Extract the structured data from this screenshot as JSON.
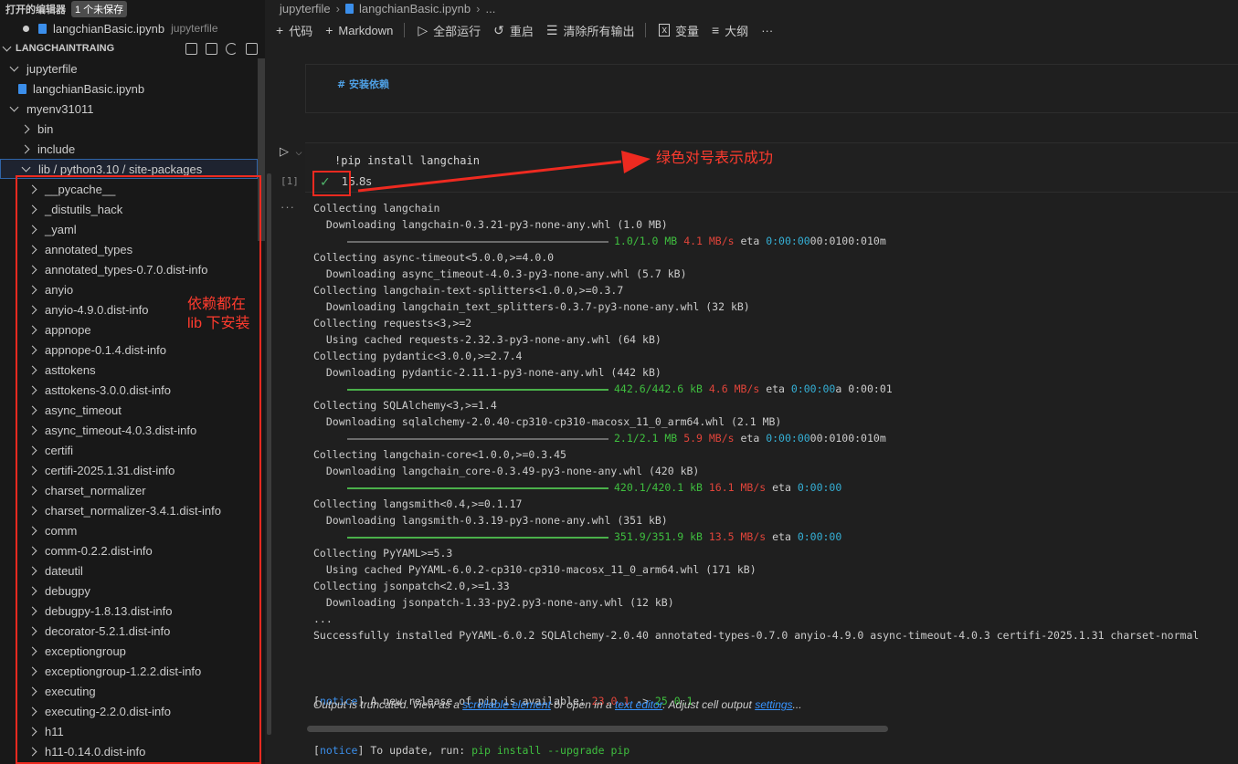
{
  "explorer": {
    "open_editors_label": "打开的编辑器",
    "unsaved_badge": "1 个未保存",
    "open_file": "langchianBasic.ipynb",
    "open_file_desc": "jupyterfile",
    "project": "LANGCHAINTRAING",
    "tree": [
      {
        "label": "jupyterfile",
        "expanded": true
      },
      {
        "label": "langchianBasic.ipynb",
        "file": true
      },
      {
        "label": "myenv31011",
        "expanded": true
      },
      {
        "label": "bin"
      },
      {
        "label": "include"
      },
      {
        "label": "lib / python3.10 / site-packages",
        "expanded": true
      },
      {
        "label": "__pycache__"
      },
      {
        "label": "_distutils_hack"
      },
      {
        "label": "_yaml"
      },
      {
        "label": "annotated_types"
      },
      {
        "label": "annotated_types-0.7.0.dist-info"
      },
      {
        "label": "anyio"
      },
      {
        "label": "anyio-4.9.0.dist-info"
      },
      {
        "label": "appnope"
      },
      {
        "label": "appnope-0.1.4.dist-info"
      },
      {
        "label": "asttokens"
      },
      {
        "label": "asttokens-3.0.0.dist-info"
      },
      {
        "label": "async_timeout"
      },
      {
        "label": "async_timeout-4.0.3.dist-info"
      },
      {
        "label": "certifi"
      },
      {
        "label": "certifi-2025.1.31.dist-info"
      },
      {
        "label": "charset_normalizer"
      },
      {
        "label": "charset_normalizer-3.4.1.dist-info"
      },
      {
        "label": "comm"
      },
      {
        "label": "comm-0.2.2.dist-info"
      },
      {
        "label": "dateutil"
      },
      {
        "label": "debugpy"
      },
      {
        "label": "debugpy-1.8.13.dist-info"
      },
      {
        "label": "decorator-5.2.1.dist-info"
      },
      {
        "label": "exceptiongroup"
      },
      {
        "label": "exceptiongroup-1.2.2.dist-info"
      },
      {
        "label": "executing"
      },
      {
        "label": "executing-2.2.0.dist-info"
      },
      {
        "label": "h11"
      },
      {
        "label": "h11-0.14.0.dist-info"
      }
    ]
  },
  "annotations": {
    "lib_note_line1": "依赖都在",
    "lib_note_line2": "lib 下安装",
    "success_note": "绿色对号表示成功",
    "color": "#ee2a20"
  },
  "breadcrumb": [
    "jupyterfile",
    "langchianBasic.ipynb",
    "..."
  ],
  "toolbar": {
    "code": "代码",
    "markdown": "Markdown",
    "run_all": "全部运行",
    "restart": "重启",
    "clear": "清除所有输出",
    "variables": "变量",
    "outline": "大纲",
    "more": "···"
  },
  "markdown_cell": "# 安装依赖",
  "code_cell": {
    "code": "!pip install langchain",
    "exec_count": "[1]",
    "duration": "15.8s",
    "status": "success"
  },
  "output": {
    "lines": [
      {
        "t": "Collecting langchain"
      },
      {
        "t": "  Downloading langchain-0.3.21-py3-none-any.whl (1.0 MB)"
      },
      {
        "bar": true,
        "green": false,
        "progress": 1.0,
        "size": "1.0/1.0 MB",
        "speed": "4.1 MB/s",
        "eta": "0:00:00",
        "tail": "00:0100:010m"
      },
      {
        "t": "Collecting async-timeout<5.0.0,>=4.0.0"
      },
      {
        "t": "  Downloading async_timeout-4.0.3-py3-none-any.whl (5.7 kB)"
      },
      {
        "t": "Collecting langchain-text-splitters<1.0.0,>=0.3.7"
      },
      {
        "t": "  Downloading langchain_text_splitters-0.3.7-py3-none-any.whl (32 kB)"
      },
      {
        "t": "Collecting requests<3,>=2"
      },
      {
        "t": "  Using cached requests-2.32.3-py3-none-any.whl (64 kB)"
      },
      {
        "t": "Collecting pydantic<3.0.0,>=2.7.4"
      },
      {
        "t": "  Downloading pydantic-2.11.1-py3-none-any.whl (442 kB)"
      },
      {
        "bar": true,
        "green": true,
        "progress": 1.0,
        "size": "442.6/442.6 kB",
        "speed": "4.6 MB/s",
        "eta": "0:00:00",
        "tail": "a 0:00:01"
      },
      {
        "t": "Collecting SQLAlchemy<3,>=1.4"
      },
      {
        "t": "  Downloading sqlalchemy-2.0.40-cp310-cp310-macosx_11_0_arm64.whl (2.1 MB)"
      },
      {
        "bar": true,
        "green": false,
        "progress": 1.0,
        "size": "2.1/2.1 MB",
        "speed": "5.9 MB/s",
        "eta": "0:00:00",
        "tail": "00:0100:010m"
      },
      {
        "t": "Collecting langchain-core<1.0.0,>=0.3.45"
      },
      {
        "t": "  Downloading langchain_core-0.3.49-py3-none-any.whl (420 kB)"
      },
      {
        "bar": true,
        "green": true,
        "progress": 1.0,
        "size": "420.1/420.1 kB",
        "speed": "16.1 MB/s",
        "eta": "0:00:00",
        "tail": ""
      },
      {
        "t": "Collecting langsmith<0.4,>=0.1.17"
      },
      {
        "t": "  Downloading langsmith-0.3.19-py3-none-any.whl (351 kB)"
      },
      {
        "bar": true,
        "green": true,
        "progress": 1.0,
        "size": "351.9/351.9 kB",
        "speed": "13.5 MB/s",
        "eta": "0:00:00",
        "tail": ""
      },
      {
        "t": "Collecting PyYAML>=5.3"
      },
      {
        "t": "  Using cached PyYAML-6.0.2-cp310-cp310-macosx_11_0_arm64.whl (171 kB)"
      },
      {
        "t": "Collecting jsonpatch<2.0,>=1.33"
      },
      {
        "t": "  Downloading jsonpatch-1.33-py2.py3-none-any.whl (12 kB)"
      },
      {
        "t": "..."
      },
      {
        "t": "Successfully installed PyYAML-6.0.2 SQLAlchemy-2.0.40 annotated-types-0.7.0 anyio-4.9.0 async-timeout-4.0.3 certifi-2025.1.31 charset-normal"
      },
      {
        "t": ""
      }
    ],
    "notice1": {
      "tag": "notice",
      "text": "A new release of pip is available: ",
      "old": "23.0.1",
      "arrow": " -> ",
      "new": "25.0.1"
    },
    "notice2": {
      "tag": "notice",
      "text": "To update, run: ",
      "cmd": "pip install --upgrade pip"
    },
    "truncated": {
      "prefix": "Output is truncated. View as a ",
      "link1": "scrollable element",
      "mid1": " or open in a ",
      "link2": "text editor",
      "mid2": ". Adjust cell output ",
      "link3": "settings",
      "suffix": "..."
    }
  }
}
